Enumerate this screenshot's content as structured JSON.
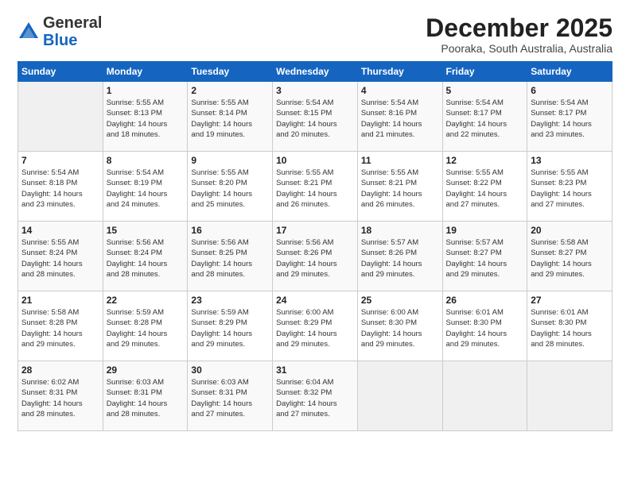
{
  "header": {
    "logo_general": "General",
    "logo_blue": "Blue",
    "month_title": "December 2025",
    "location": "Pooraka, South Australia, Australia"
  },
  "calendar": {
    "days_of_week": [
      "Sunday",
      "Monday",
      "Tuesday",
      "Wednesday",
      "Thursday",
      "Friday",
      "Saturday"
    ],
    "weeks": [
      [
        {
          "day": "",
          "info": ""
        },
        {
          "day": "1",
          "info": "Sunrise: 5:55 AM\nSunset: 8:13 PM\nDaylight: 14 hours\nand 18 minutes."
        },
        {
          "day": "2",
          "info": "Sunrise: 5:55 AM\nSunset: 8:14 PM\nDaylight: 14 hours\nand 19 minutes."
        },
        {
          "day": "3",
          "info": "Sunrise: 5:54 AM\nSunset: 8:15 PM\nDaylight: 14 hours\nand 20 minutes."
        },
        {
          "day": "4",
          "info": "Sunrise: 5:54 AM\nSunset: 8:16 PM\nDaylight: 14 hours\nand 21 minutes."
        },
        {
          "day": "5",
          "info": "Sunrise: 5:54 AM\nSunset: 8:17 PM\nDaylight: 14 hours\nand 22 minutes."
        },
        {
          "day": "6",
          "info": "Sunrise: 5:54 AM\nSunset: 8:17 PM\nDaylight: 14 hours\nand 23 minutes."
        }
      ],
      [
        {
          "day": "7",
          "info": "Sunrise: 5:54 AM\nSunset: 8:18 PM\nDaylight: 14 hours\nand 23 minutes."
        },
        {
          "day": "8",
          "info": "Sunrise: 5:54 AM\nSunset: 8:19 PM\nDaylight: 14 hours\nand 24 minutes."
        },
        {
          "day": "9",
          "info": "Sunrise: 5:55 AM\nSunset: 8:20 PM\nDaylight: 14 hours\nand 25 minutes."
        },
        {
          "day": "10",
          "info": "Sunrise: 5:55 AM\nSunset: 8:21 PM\nDaylight: 14 hours\nand 26 minutes."
        },
        {
          "day": "11",
          "info": "Sunrise: 5:55 AM\nSunset: 8:21 PM\nDaylight: 14 hours\nand 26 minutes."
        },
        {
          "day": "12",
          "info": "Sunrise: 5:55 AM\nSunset: 8:22 PM\nDaylight: 14 hours\nand 27 minutes."
        },
        {
          "day": "13",
          "info": "Sunrise: 5:55 AM\nSunset: 8:23 PM\nDaylight: 14 hours\nand 27 minutes."
        }
      ],
      [
        {
          "day": "14",
          "info": "Sunrise: 5:55 AM\nSunset: 8:24 PM\nDaylight: 14 hours\nand 28 minutes."
        },
        {
          "day": "15",
          "info": "Sunrise: 5:56 AM\nSunset: 8:24 PM\nDaylight: 14 hours\nand 28 minutes."
        },
        {
          "day": "16",
          "info": "Sunrise: 5:56 AM\nSunset: 8:25 PM\nDaylight: 14 hours\nand 28 minutes."
        },
        {
          "day": "17",
          "info": "Sunrise: 5:56 AM\nSunset: 8:26 PM\nDaylight: 14 hours\nand 29 minutes."
        },
        {
          "day": "18",
          "info": "Sunrise: 5:57 AM\nSunset: 8:26 PM\nDaylight: 14 hours\nand 29 minutes."
        },
        {
          "day": "19",
          "info": "Sunrise: 5:57 AM\nSunset: 8:27 PM\nDaylight: 14 hours\nand 29 minutes."
        },
        {
          "day": "20",
          "info": "Sunrise: 5:58 AM\nSunset: 8:27 PM\nDaylight: 14 hours\nand 29 minutes."
        }
      ],
      [
        {
          "day": "21",
          "info": "Sunrise: 5:58 AM\nSunset: 8:28 PM\nDaylight: 14 hours\nand 29 minutes."
        },
        {
          "day": "22",
          "info": "Sunrise: 5:59 AM\nSunset: 8:28 PM\nDaylight: 14 hours\nand 29 minutes."
        },
        {
          "day": "23",
          "info": "Sunrise: 5:59 AM\nSunset: 8:29 PM\nDaylight: 14 hours\nand 29 minutes."
        },
        {
          "day": "24",
          "info": "Sunrise: 6:00 AM\nSunset: 8:29 PM\nDaylight: 14 hours\nand 29 minutes."
        },
        {
          "day": "25",
          "info": "Sunrise: 6:00 AM\nSunset: 8:30 PM\nDaylight: 14 hours\nand 29 minutes."
        },
        {
          "day": "26",
          "info": "Sunrise: 6:01 AM\nSunset: 8:30 PM\nDaylight: 14 hours\nand 29 minutes."
        },
        {
          "day": "27",
          "info": "Sunrise: 6:01 AM\nSunset: 8:30 PM\nDaylight: 14 hours\nand 28 minutes."
        }
      ],
      [
        {
          "day": "28",
          "info": "Sunrise: 6:02 AM\nSunset: 8:31 PM\nDaylight: 14 hours\nand 28 minutes."
        },
        {
          "day": "29",
          "info": "Sunrise: 6:03 AM\nSunset: 8:31 PM\nDaylight: 14 hours\nand 28 minutes."
        },
        {
          "day": "30",
          "info": "Sunrise: 6:03 AM\nSunset: 8:31 PM\nDaylight: 14 hours\nand 27 minutes."
        },
        {
          "day": "31",
          "info": "Sunrise: 6:04 AM\nSunset: 8:32 PM\nDaylight: 14 hours\nand 27 minutes."
        },
        {
          "day": "",
          "info": ""
        },
        {
          "day": "",
          "info": ""
        },
        {
          "day": "",
          "info": ""
        }
      ]
    ]
  }
}
